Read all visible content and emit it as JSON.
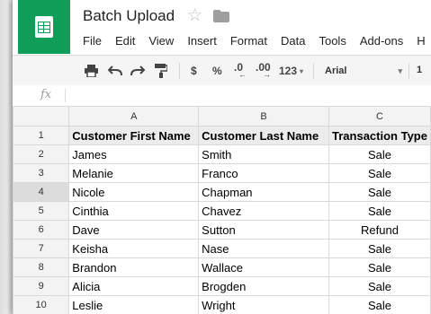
{
  "app": {
    "doc_title": "Batch Upload",
    "brand_color": "#0f9d58"
  },
  "menu": [
    "File",
    "Edit",
    "View",
    "Insert",
    "Format",
    "Data",
    "Tools",
    "Add-ons",
    "H"
  ],
  "toolbar": {
    "currency": "$",
    "percent": "%",
    "dec_decrease": ".0",
    "dec_increase": ".00",
    "more_formats": "123",
    "font": "Arial",
    "font_size": "1"
  },
  "formula_bar": {
    "fx_label": "fx",
    "value": ""
  },
  "columns": [
    "A",
    "B",
    "C"
  ],
  "rows": [
    {
      "num": "1",
      "a": "Customer First Name",
      "b": "Customer Last Name",
      "c": "Transaction Type"
    },
    {
      "num": "2",
      "a": "James",
      "b": "Smith",
      "c": "Sale"
    },
    {
      "num": "3",
      "a": "Melanie",
      "b": "Franco",
      "c": "Sale"
    },
    {
      "num": "4",
      "a": "Nicole",
      "b": "Chapman",
      "c": "Sale"
    },
    {
      "num": "5",
      "a": "Cinthia",
      "b": "Chavez",
      "c": "Sale"
    },
    {
      "num": "6",
      "a": "Dave",
      "b": "Sutton",
      "c": "Refund"
    },
    {
      "num": "7",
      "a": "Keisha",
      "b": "Nase",
      "c": "Sale"
    },
    {
      "num": "8",
      "a": "Brandon",
      "b": "Wallace",
      "c": "Sale"
    },
    {
      "num": "9",
      "a": "Alicia",
      "b": "Brogden",
      "c": "Sale"
    },
    {
      "num": "10",
      "a": "Leslie",
      "b": "Wright",
      "c": "Sale"
    }
  ]
}
